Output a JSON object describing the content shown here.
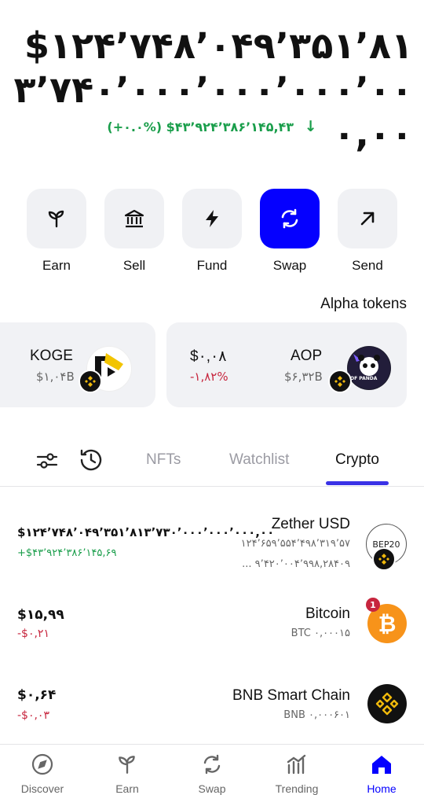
{
  "balance": {
    "value": "$۱۲۴٬۷۴۸٬۰۴۹٬۳۵۱٬۸۱۳٬۷۴۰٬۰۰۰٬۰۰۰٬۰۰۰٬۰۰۰,۰۰",
    "change": "(+۰.۰%) $۴۳٬۹۲۴٬۳۸۶٬۱۴۵,۴۳",
    "change_arrow": "↓"
  },
  "actions": [
    {
      "label": "Earn",
      "icon": "sprout-icon"
    },
    {
      "label": "Sell",
      "icon": "bank-icon"
    },
    {
      "label": "Fund",
      "icon": "bolt-icon"
    },
    {
      "label": "Swap",
      "icon": "swap-icon"
    },
    {
      "label": "Send",
      "icon": "arrow-up-right-icon"
    }
  ],
  "alpha": {
    "title": "Alpha tokens",
    "cards": [
      {
        "name": "KOGE",
        "price": "$۱,۰۴B",
        "change": ""
      },
      {
        "name": "AOP",
        "price": "$۶,۳۲B",
        "value": "$۰,۰۸",
        "change": "-۱,۸۲%",
        "logo_text": "OF PANDA"
      }
    ]
  },
  "tabs": {
    "filter_icon": "sliders-icon",
    "history_icon": "history-icon",
    "items": [
      "NFTs",
      "Watchlist",
      "Crypto"
    ],
    "active": "Crypto"
  },
  "assets": [
    {
      "name": "Zether USD",
      "amount": "$۱۲۴٬۷۴۸٬۰۴۹٬۳۵۱٬۸۱۳٬۷۳۰٬۰۰۰٬۰۰۰٬۰۰۰,۰۰",
      "pnl": "+$۴۳٬۹۲۴٬۳۸۶٬۱۴۵,۶۹",
      "sub1": "۱۲۴٬۶۵۹٬۵۵۴٬۴۹۸٬۳۱۹٬۵۷",
      "sub2": "... ۹٬۴۲۰٬۰۰۴٬۹۹۸,۲۸۴۰۹",
      "icon_text": "BEP20"
    },
    {
      "name": "Bitcoin",
      "amount": "$۱۵,۹۹",
      "pnl": "-$۰,۲۱",
      "sub": "BTC ۰,۰۰۰۱۵",
      "notification": "1",
      "color": "#f7931a"
    },
    {
      "name": "BNB Smart Chain",
      "amount": "$۰,۶۴",
      "pnl": "-$۰,۰۳",
      "sub": "BNB ۰,۰۰۰۶۰۱",
      "color": "#111111"
    }
  ],
  "nav": [
    {
      "label": "Discover",
      "icon": "compass-icon"
    },
    {
      "label": "Earn",
      "icon": "sprout-icon"
    },
    {
      "label": "Swap",
      "icon": "swap-icon"
    },
    {
      "label": "Trending",
      "icon": "bar-chart-icon"
    },
    {
      "label": "Home",
      "icon": "home-icon",
      "active": true
    }
  ],
  "colors": {
    "accent": "#0500ff",
    "up": "#1a9e4b",
    "down": "#c7263e",
    "tab_underline": "#3a32e6"
  }
}
